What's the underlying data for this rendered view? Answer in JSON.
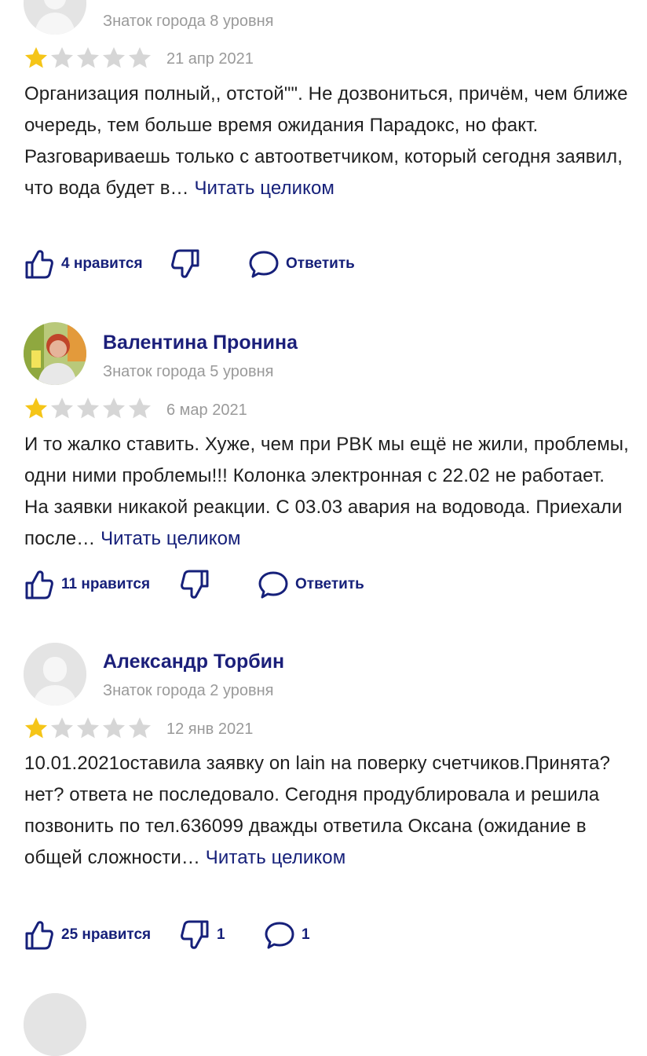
{
  "colors": {
    "accent": "#16207a",
    "author": "#1b1f7a",
    "star_filled": "#f5c518",
    "star_empty": "#d6d6d6",
    "muted": "#9a9a9a"
  },
  "reviews": [
    {
      "author": "",
      "level": "Знаток города 8 уровня",
      "rating": 1,
      "date": "21 апр 2021",
      "text": "Организация полный,, отстой\"\". Не дозвониться, причём, чем ближе очередь, тем больше время ожидания Парадокс, но факт. Разговариваешь только с автоответчиком, который сегодня заявил, что вода будет в…",
      "read_more": "Читать целиком",
      "likes_label": "4 нравится",
      "dislikes_label": "",
      "reply_label": "Ответить",
      "avatar": "generic-photo"
    },
    {
      "author": "Валентина Пронина",
      "level": "Знаток города 5 уровня",
      "rating": 1,
      "date": "6 мар 2021",
      "text": "И то жалко ставить. Хуже, чем при РВК мы ещё не жили, проблемы, одни ними проблемы!!! Колонка электронная с 22.02 не работает. На заявки никакой реакции. С 03.03 авария на водовода. Приехали после…",
      "read_more": "Читать целиком",
      "likes_label": "11 нравится",
      "dislikes_label": "",
      "reply_label": "Ответить",
      "avatar": "user-photo"
    },
    {
      "author": "Александр Торбин",
      "level": "Знаток города 2 уровня",
      "rating": 1,
      "date": "12 янв 2021",
      "text": "10.01.2021оставила заявку on lain на поверку счетчиков.Принята? нет? ответа не последовало. Сегодня продублировала и решила позвонить по тел.636099 дважды ответила Оксана (ожидание в общей сложности…",
      "read_more": "Читать целиком",
      "likes_label": "25 нравится",
      "dislikes_label": "1",
      "reply_label": "1",
      "avatar": "placeholder-silhouette"
    }
  ]
}
